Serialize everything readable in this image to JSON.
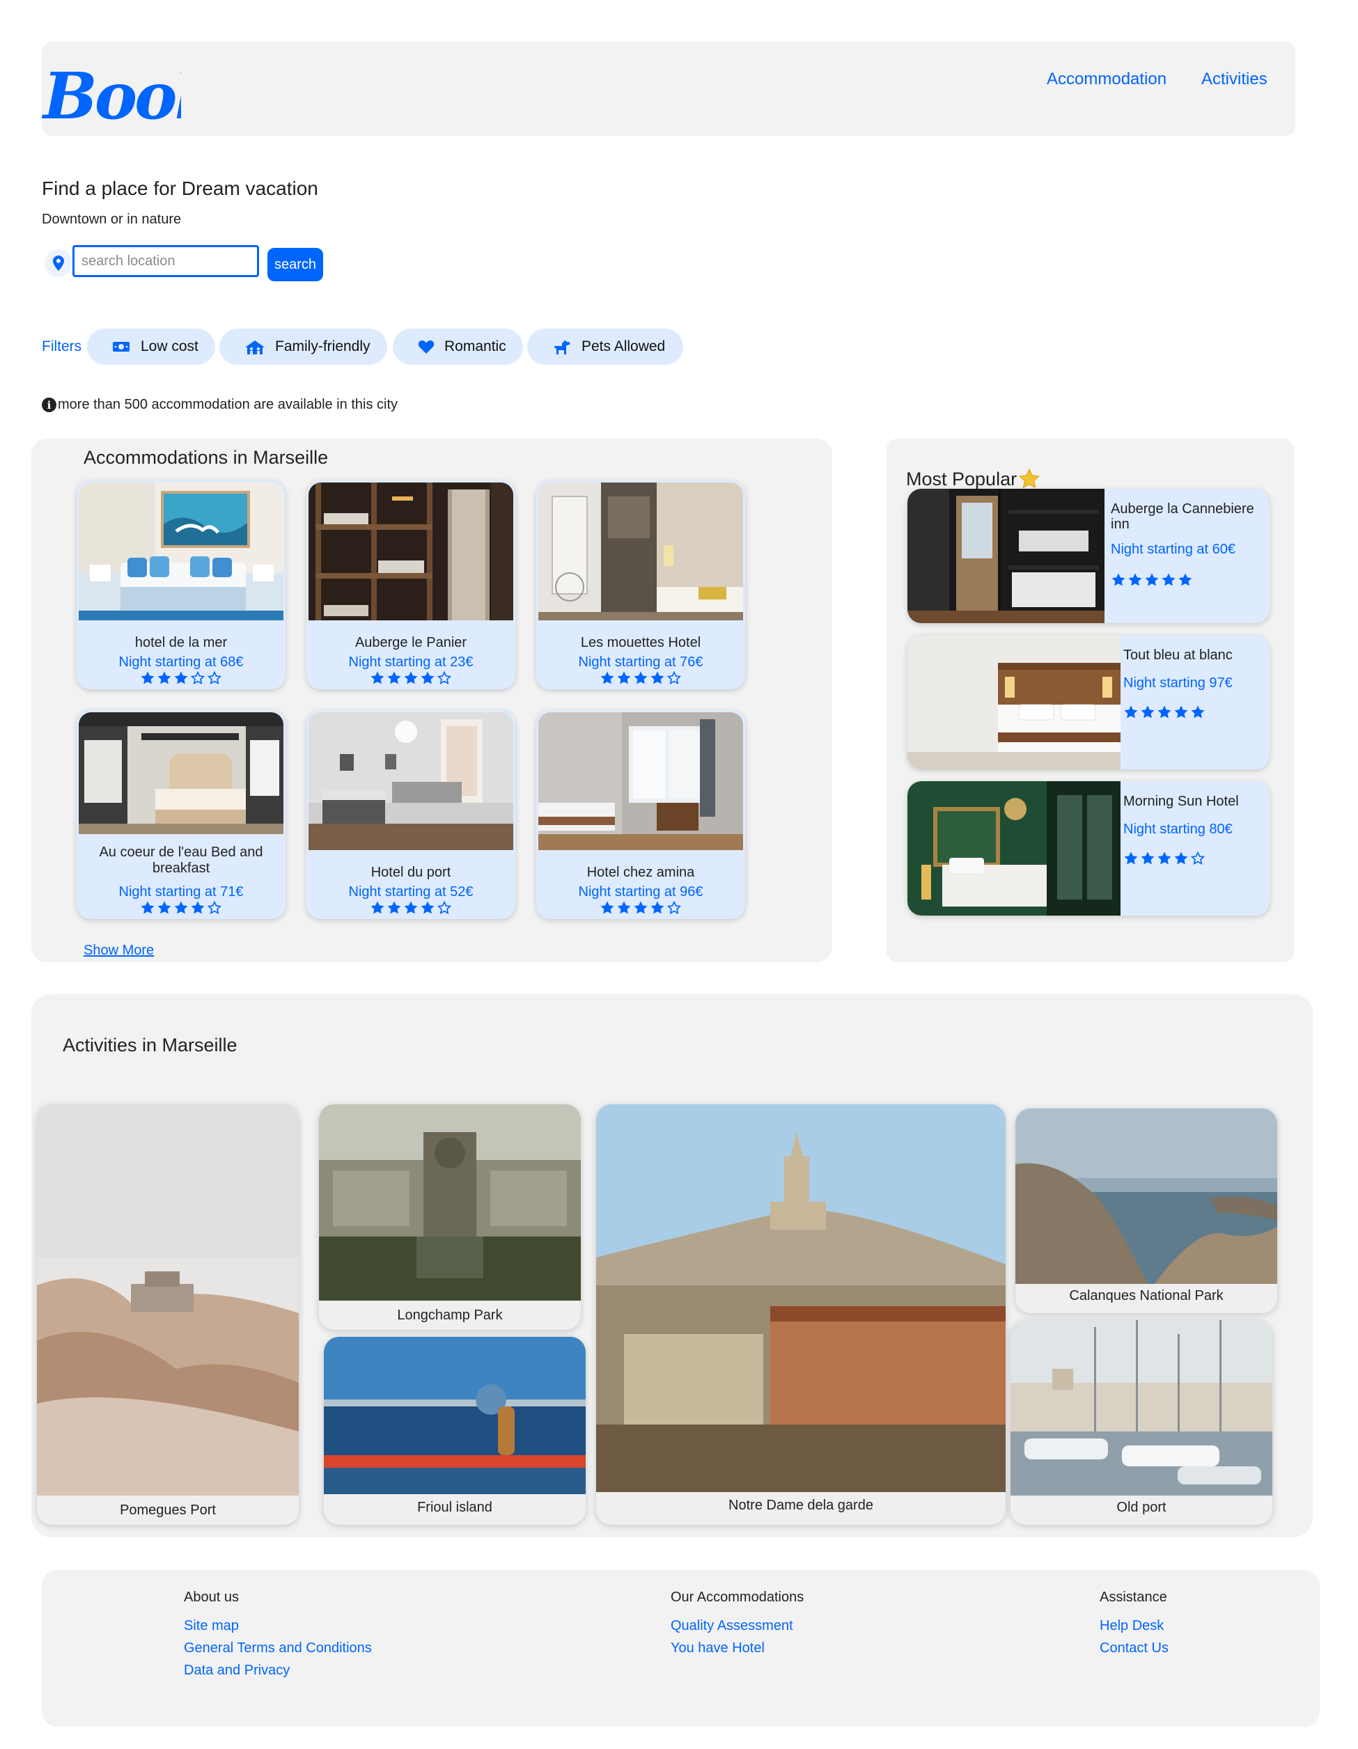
{
  "header": {
    "logo_text": "Booki",
    "nav": [
      {
        "label": "Accommodation"
      },
      {
        "label": "Activities"
      }
    ]
  },
  "hero": {
    "title": "Find a place for Dream vacation",
    "subtitle": "Downtown or in nature",
    "search": {
      "placeholder": "search location",
      "value": "",
      "button_label": "search"
    }
  },
  "filters": {
    "label": "Filters",
    "items": [
      {
        "label": "Low cost",
        "icon": "money-bill-icon"
      },
      {
        "label": "Family-friendly",
        "icon": "family-icon"
      },
      {
        "label": "Romantic",
        "icon": "heart-icon"
      },
      {
        "label": "Pets Allowed",
        "icon": "dog-icon"
      }
    ]
  },
  "info": {
    "text": "more than 500 accommodation are available in this city",
    "icon": "info-circle-icon"
  },
  "accommodations": {
    "title": "Accommodations in Marseille",
    "show_more": "Show More",
    "items": [
      {
        "name": "hotel de la mer",
        "price": "Night starting at 68€",
        "rating": 3
      },
      {
        "name": "Auberge le Panier",
        "price": "Night starting at 23€",
        "rating": 4
      },
      {
        "name": "Les mouettes Hotel",
        "price": "Night starting at 76€",
        "rating": 4
      },
      {
        "name": "Au coeur de l'eau Bed and breakfast",
        "price": "Night starting at 71€",
        "rating": 4
      },
      {
        "name": "Hotel du port",
        "price": "Night starting at 52€",
        "rating": 4
      },
      {
        "name": "Hotel chez amina",
        "price": "Night starting at 96€",
        "rating": 4
      }
    ]
  },
  "popular": {
    "title": "Most Popular",
    "items": [
      {
        "name": "Auberge la Cannebiere inn",
        "price": "Night starting at 60€",
        "rating": 5
      },
      {
        "name": "Tout bleu at blanc",
        "price": "Night starting 97€",
        "rating": 5
      },
      {
        "name": "Morning Sun Hotel",
        "price": "Night starting 80€",
        "rating": 4
      }
    ]
  },
  "activities": {
    "title": "Activities in Marseille",
    "items": [
      {
        "label": "Pomegues Port"
      },
      {
        "label": "Longchamp Park"
      },
      {
        "label": "Frioul island"
      },
      {
        "label": "Notre Dame dela garde"
      },
      {
        "label": "Calanques National Park"
      },
      {
        "label": "Old port"
      }
    ]
  },
  "footer": {
    "columns": [
      {
        "heading": "About us",
        "links": [
          "Site map",
          "General Terms and Conditions",
          "Data and Privacy"
        ]
      },
      {
        "heading": "Our Accommodations",
        "links": [
          "Quality Assessment",
          "You have Hotel"
        ]
      },
      {
        "heading": "Assistance",
        "links": [
          "Help Desk",
          "Contact Us"
        ]
      }
    ]
  },
  "colors": {
    "primary": "#0065fc",
    "secondary": "#deebff",
    "panel": "#f2f2f2",
    "star_popular": "#f2c230"
  }
}
